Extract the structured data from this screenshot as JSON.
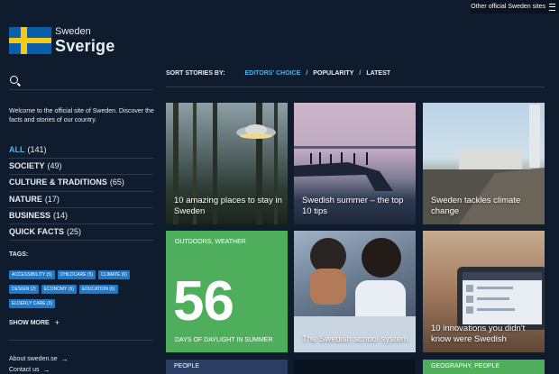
{
  "topbar": {
    "label": "Other official Sweden sites",
    "icon": "menu-icon"
  },
  "logo": {
    "small": "Sweden",
    "big": "Sverige"
  },
  "search": {
    "icon": "search-icon"
  },
  "welcome": "Welcome to the official site of Sweden. Discover the facts and stories of our country.",
  "categories": [
    {
      "label": "ALL",
      "count": "(141)",
      "active": true
    },
    {
      "label": "SOCIETY",
      "count": "(49)"
    },
    {
      "label": "CULTURE & TRADITIONS",
      "count": "(65)"
    },
    {
      "label": "NATURE",
      "count": "(17)"
    },
    {
      "label": "BUSINESS",
      "count": "(14)"
    },
    {
      "label": "QUICK FACTS",
      "count": "(25)"
    }
  ],
  "tags_title": "TAGS:",
  "tags": [
    "ACCESSIBILITY (5)",
    "CHILDCARE (5)",
    "CLIMATE (6)",
    "DESIGN (2)",
    "ECONOMY (5)",
    "EDUCATION (6)",
    "ELDERLY CARE (3)"
  ],
  "show_more": "SHOW MORE",
  "footer": {
    "about": "About sweden.se",
    "contact": "Contact us"
  },
  "sort": {
    "label": "SORT STORIES BY:",
    "options": [
      "EDITORS' CHOICE",
      "POPULARITY",
      "LATEST"
    ]
  },
  "cards": {
    "c1": "10 amazing places to stay in Sweden",
    "c2": "Swedish summer – the top 10 tips",
    "c3": "Sweden tackles climate change",
    "c5": "The Swedish school system",
    "c6": "10 innovations you didn't know were Swedish"
  },
  "stat": {
    "tagline": "OUTDOORS, WEATHER",
    "number": "56",
    "description": "DAYS OF DAYLIGHT IN SUMMER"
  },
  "bottom": {
    "b1": "PEOPLE",
    "b3": "GEOGRAPHY, PEOPLE"
  },
  "colors": {
    "accent": "#4fb3ea",
    "green": "#4fae5b",
    "background": "#0f1c2d",
    "tag": "#2178c5"
  }
}
